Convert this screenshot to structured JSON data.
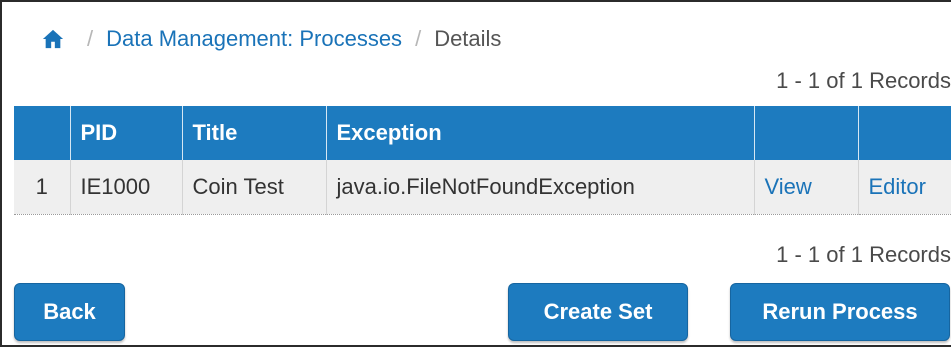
{
  "breadcrumb": {
    "home_icon": "home-icon",
    "separator": "/",
    "parent": "Data Management: Processes",
    "current": "Details"
  },
  "records": {
    "top": "1 - 1 of 1 Records",
    "bottom": "1 - 1 of 1 Records"
  },
  "table": {
    "columns": [
      "",
      "PID",
      "Title",
      "Exception",
      "",
      ""
    ],
    "rows": [
      {
        "index": "1",
        "pid": "IE1000",
        "title": "Coin Test",
        "exception": "java.io.FileNotFoundException",
        "view": "View",
        "editor": "Editor"
      }
    ]
  },
  "buttons": {
    "back": "Back",
    "create_set": "Create Set",
    "rerun_process": "Rerun Process"
  },
  "colors": {
    "header_bg": "#1d7bbf",
    "link": "#1a73b8",
    "row_bg": "#efefef"
  }
}
